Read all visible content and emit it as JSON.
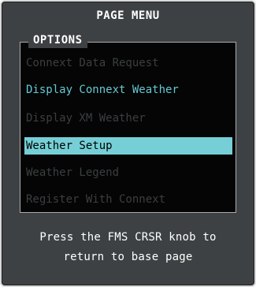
{
  "menu": {
    "title": "PAGE MENU",
    "section_label": "OPTIONS",
    "items": [
      {
        "label": "Connext Data Request",
        "state": "disabled"
      },
      {
        "label": "Display Connext Weather",
        "state": "enabled"
      },
      {
        "label": "Display XM Weather",
        "state": "disabled"
      },
      {
        "label": "Weather Setup",
        "state": "selected"
      },
      {
        "label": "Weather Legend",
        "state": "disabled"
      },
      {
        "label": "Register With Connext",
        "state": "disabled"
      }
    ],
    "footer_line1": "Press the FMS CRSR knob to",
    "footer_line2": "return to base page"
  },
  "colors": {
    "panel_bg": "#3d4143",
    "list_bg": "#050505",
    "enabled_text": "#64c8d2",
    "disabled_text": "#3b3f41",
    "selection_bg": "#76cfd6"
  }
}
